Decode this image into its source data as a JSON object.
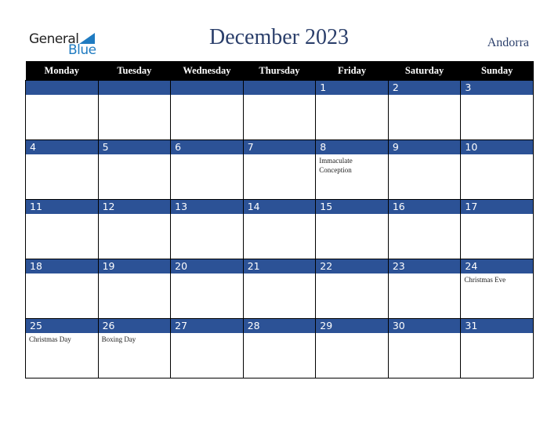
{
  "logo": {
    "general": "General",
    "blue": "Blue"
  },
  "title": "December 2023",
  "country": "Andorra",
  "weekdays": [
    "Monday",
    "Tuesday",
    "Wednesday",
    "Thursday",
    "Friday",
    "Saturday",
    "Sunday"
  ],
  "weeks": [
    [
      {
        "d": "",
        "e": ""
      },
      {
        "d": "",
        "e": ""
      },
      {
        "d": "",
        "e": ""
      },
      {
        "d": "",
        "e": ""
      },
      {
        "d": "1",
        "e": ""
      },
      {
        "d": "2",
        "e": ""
      },
      {
        "d": "3",
        "e": ""
      }
    ],
    [
      {
        "d": "4",
        "e": ""
      },
      {
        "d": "5",
        "e": ""
      },
      {
        "d": "6",
        "e": ""
      },
      {
        "d": "7",
        "e": ""
      },
      {
        "d": "8",
        "e": "Immaculate Conception"
      },
      {
        "d": "9",
        "e": ""
      },
      {
        "d": "10",
        "e": ""
      }
    ],
    [
      {
        "d": "11",
        "e": ""
      },
      {
        "d": "12",
        "e": ""
      },
      {
        "d": "13",
        "e": ""
      },
      {
        "d": "14",
        "e": ""
      },
      {
        "d": "15",
        "e": ""
      },
      {
        "d": "16",
        "e": ""
      },
      {
        "d": "17",
        "e": ""
      }
    ],
    [
      {
        "d": "18",
        "e": ""
      },
      {
        "d": "19",
        "e": ""
      },
      {
        "d": "20",
        "e": ""
      },
      {
        "d": "21",
        "e": ""
      },
      {
        "d": "22",
        "e": ""
      },
      {
        "d": "23",
        "e": ""
      },
      {
        "d": "24",
        "e": "Christmas Eve"
      }
    ],
    [
      {
        "d": "25",
        "e": "Christmas Day"
      },
      {
        "d": "26",
        "e": "Boxing Day"
      },
      {
        "d": "27",
        "e": ""
      },
      {
        "d": "28",
        "e": ""
      },
      {
        "d": "29",
        "e": ""
      },
      {
        "d": "30",
        "e": ""
      },
      {
        "d": "31",
        "e": ""
      }
    ]
  ]
}
